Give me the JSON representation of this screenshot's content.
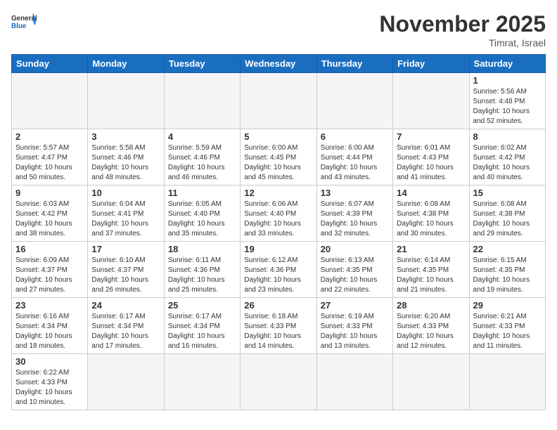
{
  "header": {
    "logo_general": "General",
    "logo_blue": "Blue",
    "month_year": "November 2025",
    "location": "Timrat, Israel"
  },
  "days_of_week": [
    "Sunday",
    "Monday",
    "Tuesday",
    "Wednesday",
    "Thursday",
    "Friday",
    "Saturday"
  ],
  "weeks": [
    [
      {
        "day": "",
        "info": ""
      },
      {
        "day": "",
        "info": ""
      },
      {
        "day": "",
        "info": ""
      },
      {
        "day": "",
        "info": ""
      },
      {
        "day": "",
        "info": ""
      },
      {
        "day": "",
        "info": ""
      },
      {
        "day": "1",
        "info": "Sunrise: 5:56 AM\nSunset: 4:48 PM\nDaylight: 10 hours and 52 minutes."
      }
    ],
    [
      {
        "day": "2",
        "info": "Sunrise: 5:57 AM\nSunset: 4:47 PM\nDaylight: 10 hours and 50 minutes."
      },
      {
        "day": "3",
        "info": "Sunrise: 5:58 AM\nSunset: 4:46 PM\nDaylight: 10 hours and 48 minutes."
      },
      {
        "day": "4",
        "info": "Sunrise: 5:59 AM\nSunset: 4:46 PM\nDaylight: 10 hours and 46 minutes."
      },
      {
        "day": "5",
        "info": "Sunrise: 6:00 AM\nSunset: 4:45 PM\nDaylight: 10 hours and 45 minutes."
      },
      {
        "day": "6",
        "info": "Sunrise: 6:00 AM\nSunset: 4:44 PM\nDaylight: 10 hours and 43 minutes."
      },
      {
        "day": "7",
        "info": "Sunrise: 6:01 AM\nSunset: 4:43 PM\nDaylight: 10 hours and 41 minutes."
      },
      {
        "day": "8",
        "info": "Sunrise: 6:02 AM\nSunset: 4:42 PM\nDaylight: 10 hours and 40 minutes."
      }
    ],
    [
      {
        "day": "9",
        "info": "Sunrise: 6:03 AM\nSunset: 4:42 PM\nDaylight: 10 hours and 38 minutes."
      },
      {
        "day": "10",
        "info": "Sunrise: 6:04 AM\nSunset: 4:41 PM\nDaylight: 10 hours and 37 minutes."
      },
      {
        "day": "11",
        "info": "Sunrise: 6:05 AM\nSunset: 4:40 PM\nDaylight: 10 hours and 35 minutes."
      },
      {
        "day": "12",
        "info": "Sunrise: 6:06 AM\nSunset: 4:40 PM\nDaylight: 10 hours and 33 minutes."
      },
      {
        "day": "13",
        "info": "Sunrise: 6:07 AM\nSunset: 4:39 PM\nDaylight: 10 hours and 32 minutes."
      },
      {
        "day": "14",
        "info": "Sunrise: 6:08 AM\nSunset: 4:38 PM\nDaylight: 10 hours and 30 minutes."
      },
      {
        "day": "15",
        "info": "Sunrise: 6:08 AM\nSunset: 4:38 PM\nDaylight: 10 hours and 29 minutes."
      }
    ],
    [
      {
        "day": "16",
        "info": "Sunrise: 6:09 AM\nSunset: 4:37 PM\nDaylight: 10 hours and 27 minutes."
      },
      {
        "day": "17",
        "info": "Sunrise: 6:10 AM\nSunset: 4:37 PM\nDaylight: 10 hours and 26 minutes."
      },
      {
        "day": "18",
        "info": "Sunrise: 6:11 AM\nSunset: 4:36 PM\nDaylight: 10 hours and 25 minutes."
      },
      {
        "day": "19",
        "info": "Sunrise: 6:12 AM\nSunset: 4:36 PM\nDaylight: 10 hours and 23 minutes."
      },
      {
        "day": "20",
        "info": "Sunrise: 6:13 AM\nSunset: 4:35 PM\nDaylight: 10 hours and 22 minutes."
      },
      {
        "day": "21",
        "info": "Sunrise: 6:14 AM\nSunset: 4:35 PM\nDaylight: 10 hours and 21 minutes."
      },
      {
        "day": "22",
        "info": "Sunrise: 6:15 AM\nSunset: 4:35 PM\nDaylight: 10 hours and 19 minutes."
      }
    ],
    [
      {
        "day": "23",
        "info": "Sunrise: 6:16 AM\nSunset: 4:34 PM\nDaylight: 10 hours and 18 minutes."
      },
      {
        "day": "24",
        "info": "Sunrise: 6:17 AM\nSunset: 4:34 PM\nDaylight: 10 hours and 17 minutes."
      },
      {
        "day": "25",
        "info": "Sunrise: 6:17 AM\nSunset: 4:34 PM\nDaylight: 10 hours and 16 minutes."
      },
      {
        "day": "26",
        "info": "Sunrise: 6:18 AM\nSunset: 4:33 PM\nDaylight: 10 hours and 14 minutes."
      },
      {
        "day": "27",
        "info": "Sunrise: 6:19 AM\nSunset: 4:33 PM\nDaylight: 10 hours and 13 minutes."
      },
      {
        "day": "28",
        "info": "Sunrise: 6:20 AM\nSunset: 4:33 PM\nDaylight: 10 hours and 12 minutes."
      },
      {
        "day": "29",
        "info": "Sunrise: 6:21 AM\nSunset: 4:33 PM\nDaylight: 10 hours and 11 minutes."
      }
    ],
    [
      {
        "day": "30",
        "info": "Sunrise: 6:22 AM\nSunset: 4:33 PM\nDaylight: 10 hours and 10 minutes."
      },
      {
        "day": "",
        "info": ""
      },
      {
        "day": "",
        "info": ""
      },
      {
        "day": "",
        "info": ""
      },
      {
        "day": "",
        "info": ""
      },
      {
        "day": "",
        "info": ""
      },
      {
        "day": "",
        "info": ""
      }
    ]
  ]
}
